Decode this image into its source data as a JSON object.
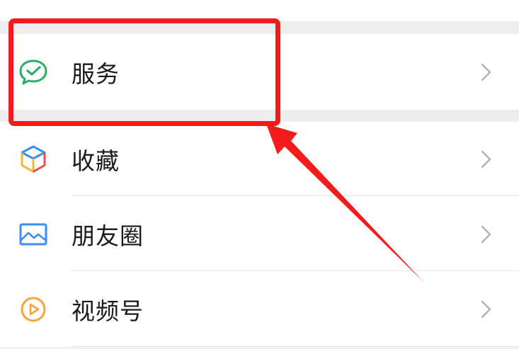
{
  "menu": {
    "items": [
      {
        "id": "service",
        "label": "服务",
        "icon": "wechat-pay-icon"
      },
      {
        "id": "favorites",
        "label": "收藏",
        "icon": "cube-icon"
      },
      {
        "id": "moments",
        "label": "朋友圈",
        "icon": "landscape-image-icon"
      },
      {
        "id": "channels",
        "label": "视频号",
        "icon": "play-aperture-icon"
      }
    ]
  },
  "annotation": {
    "highlight_color": "#f21c1c",
    "target": "服务"
  },
  "colors": {
    "section_gap": "#ededed",
    "text": "#1a1a1a",
    "chevron": "#b2b2b2",
    "service_icon": "#2aae67"
  }
}
